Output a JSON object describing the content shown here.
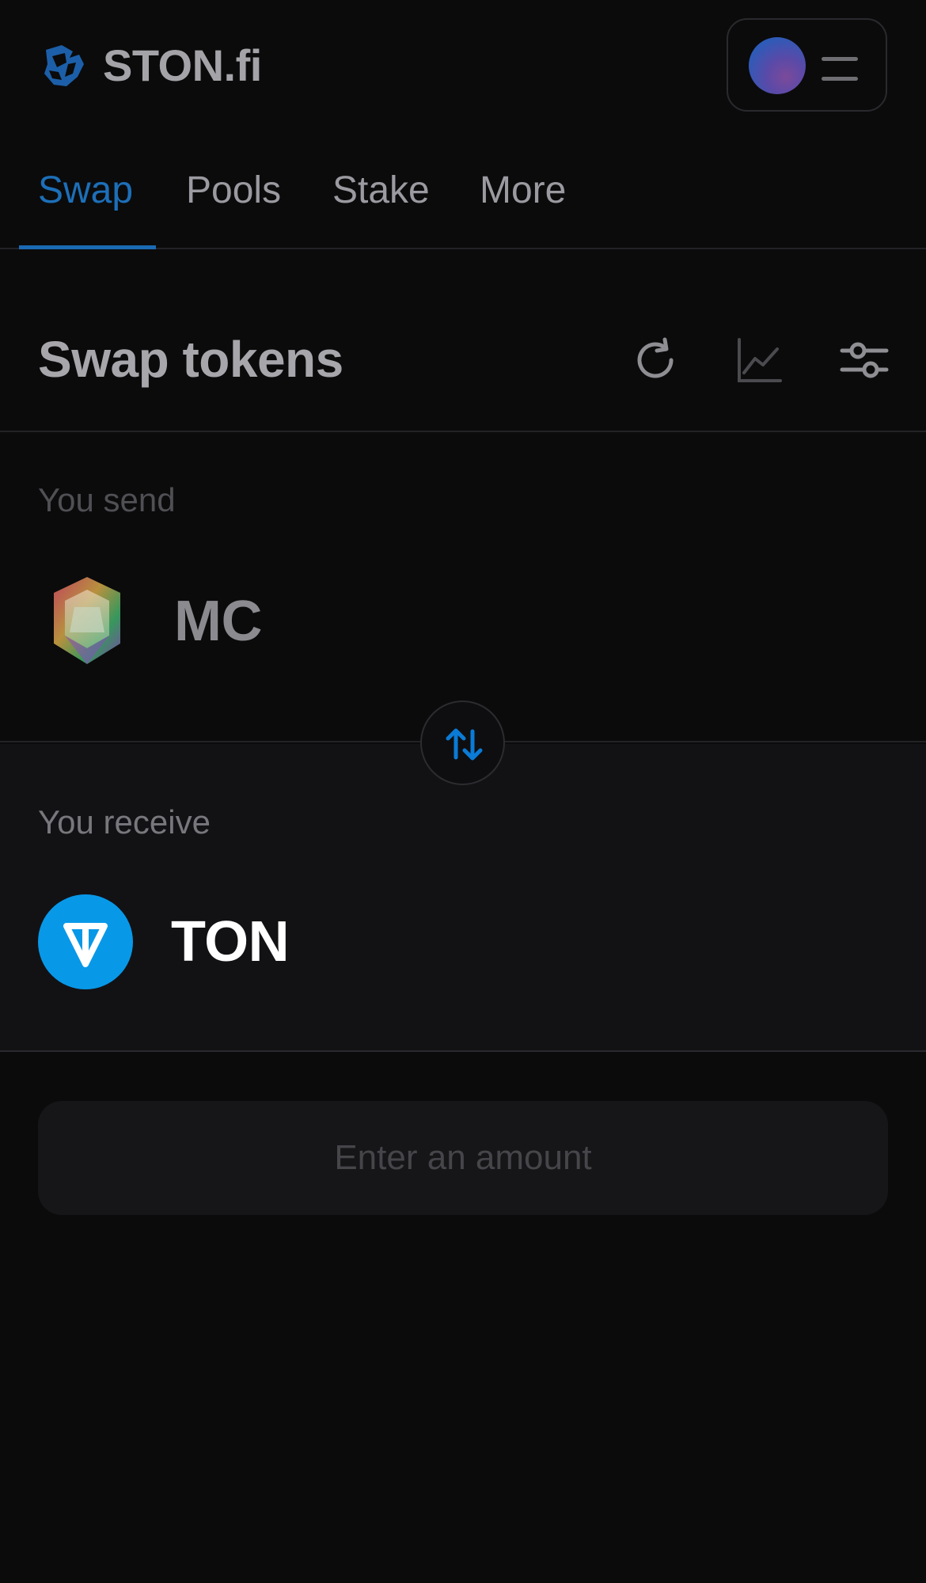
{
  "header": {
    "brand": "STON.fi",
    "logo_icon": "ston-logo-icon",
    "menu_icon": "hamburger-icon"
  },
  "tabs": [
    {
      "label": "Swap",
      "active": true
    },
    {
      "label": "Pools",
      "active": false
    },
    {
      "label": "Stake",
      "active": false
    },
    {
      "label": "More",
      "active": false
    }
  ],
  "swap": {
    "title": "Swap tokens",
    "actions": [
      "refresh-icon",
      "chart-icon",
      "settings-sliders-icon"
    ]
  },
  "send": {
    "label": "You send",
    "token": "MC"
  },
  "receive": {
    "label": "You receive",
    "token": "TON"
  },
  "cta": {
    "label": "Enter an amount"
  },
  "colors": {
    "accent": "#1d6fb8",
    "ton_blue": "#0898e8",
    "background": "#0b0b0c"
  }
}
